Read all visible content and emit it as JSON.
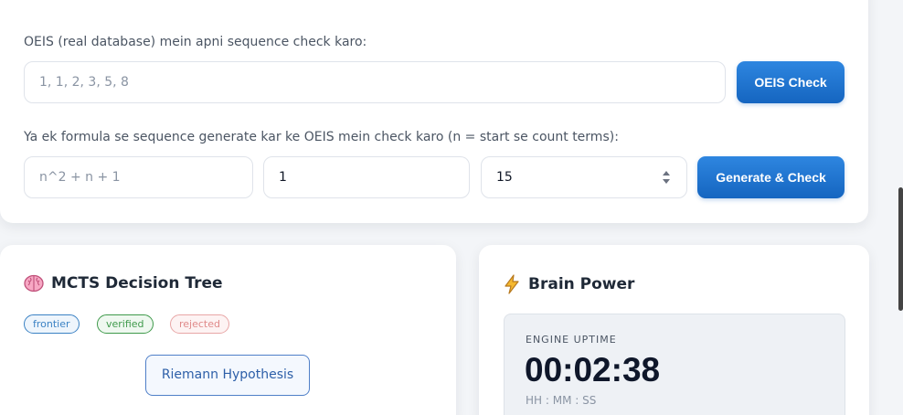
{
  "oeis": {
    "label": "OEIS (real database) mein apni sequence check karo:",
    "sequence_placeholder": "1, 1, 2, 3, 5, 8",
    "check_button": "OEIS Check"
  },
  "formula": {
    "label": "Ya ek formula se sequence generate kar ke OEIS mein check karo (n = start se count terms):",
    "formula_placeholder": "n^2 + n + 1",
    "start_value": "1",
    "count_value": "15",
    "generate_button": "Generate & Check"
  },
  "mcts": {
    "title": "MCTS Decision Tree",
    "icon": "brain-icon",
    "legend": [
      {
        "label": "frontier",
        "color": "#3b82c4"
      },
      {
        "label": "verified",
        "color": "#3f9a4b"
      },
      {
        "label": "rejected",
        "color": "#e08a8a"
      }
    ],
    "root_node": "Riemann Hypothesis"
  },
  "brain": {
    "title": "Brain Power",
    "icon": "lightning-icon",
    "uptime_label": "ENGINE UPTIME",
    "uptime_value": "00:02:38",
    "uptime_format": "HH : MM : SS"
  }
}
